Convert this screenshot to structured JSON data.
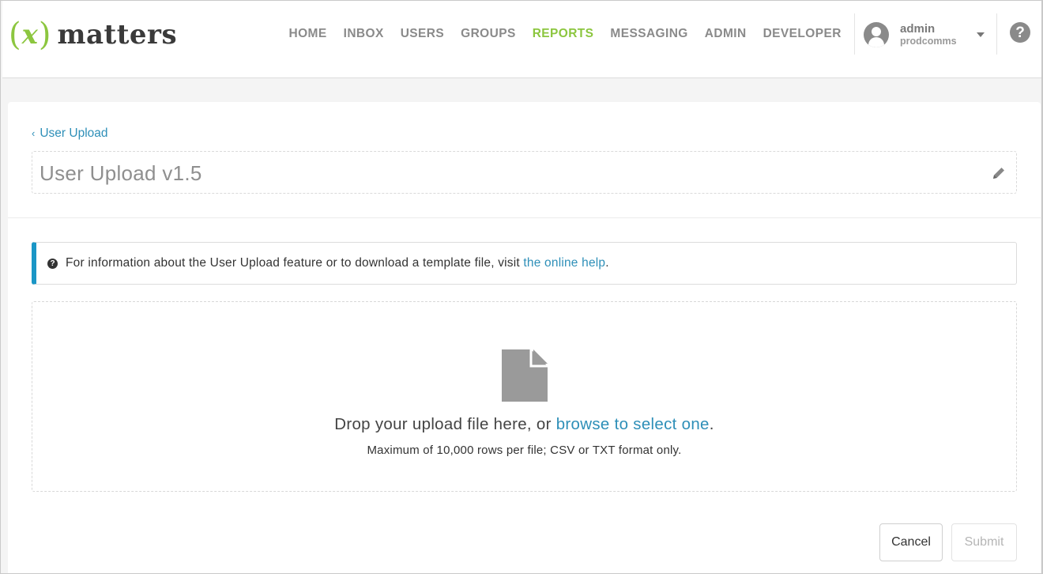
{
  "header": {
    "logo": {
      "paren_open": "(",
      "x": "x",
      "paren_close": ")",
      "word": "matters"
    },
    "nav": [
      {
        "label": "HOME"
      },
      {
        "label": "INBOX"
      },
      {
        "label": "USERS"
      },
      {
        "label": "GROUPS"
      },
      {
        "label": "REPORTS",
        "active": true
      },
      {
        "label": "MESSAGING"
      },
      {
        "label": "ADMIN"
      },
      {
        "label": "DEVELOPER"
      }
    ],
    "user": {
      "name": "admin",
      "company": "prodcomms"
    },
    "help_glyph": "?"
  },
  "page": {
    "breadcrumb": {
      "chevron": "‹",
      "label": "User Upload"
    },
    "title": "User Upload v1.5",
    "info": {
      "icon_glyph": "?",
      "text": "For information about the User Upload feature or to download a template file, visit ",
      "link": "the online help",
      "suffix": "."
    },
    "dropzone": {
      "prefix": "Drop your upload file here, or ",
      "link": "browse to select one",
      "suffix": ".",
      "hint": "Maximum of 10,000 rows per file; CSV or TXT format only."
    },
    "buttons": {
      "cancel": "Cancel",
      "submit": "Submit"
    }
  },
  "colors": {
    "brand_green": "#8cc63f",
    "link_blue": "#2e8fb8",
    "info_accent": "#1a96c6",
    "icon_gray": "#8a8a8a"
  },
  "icons": {
    "avatar": "user-avatar-icon",
    "dropdown": "caret-down-icon",
    "help": "question-circle-icon",
    "edit": "pencil-icon",
    "info": "question-circle-icon",
    "file": "file-icon"
  }
}
